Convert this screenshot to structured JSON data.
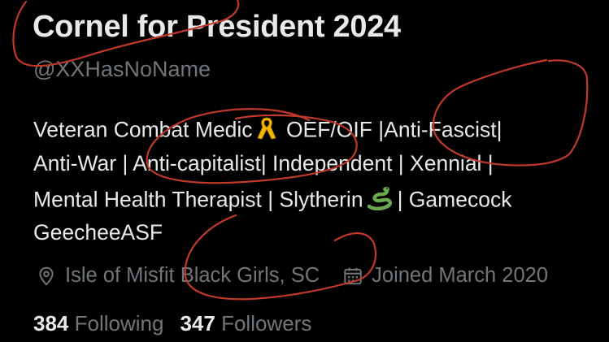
{
  "profile": {
    "display_name": "Cornel for President 2024",
    "handle": "@XXHasNoName",
    "bio": {
      "line1_a": "Veteran Combat Medic",
      "line1_b": "OEF/OIF |Anti-Fascist|",
      "line2": "Anti-War | Anti-capitalist| Independent | Xennial |",
      "line3_a": "Mental Health Therapist | Slytherin",
      "line3_b": "| Gamecock",
      "line4": "GeecheeASF"
    },
    "location": "Isle of Misfit Black Girls, SC",
    "joined": "Joined March 2020",
    "following_count": "384",
    "following_label": "Following",
    "followers_count": "347",
    "followers_label": "Followers"
  },
  "icons": {
    "location": "location-pin-icon",
    "calendar": "calendar-icon",
    "ribbon": "yellow-ribbon-emoji",
    "snake": "snake-emoji"
  },
  "colors": {
    "background": "#000000",
    "primary_text": "#e7e9ea",
    "secondary_text": "#71767b",
    "annotation_red": "#c0392b"
  }
}
